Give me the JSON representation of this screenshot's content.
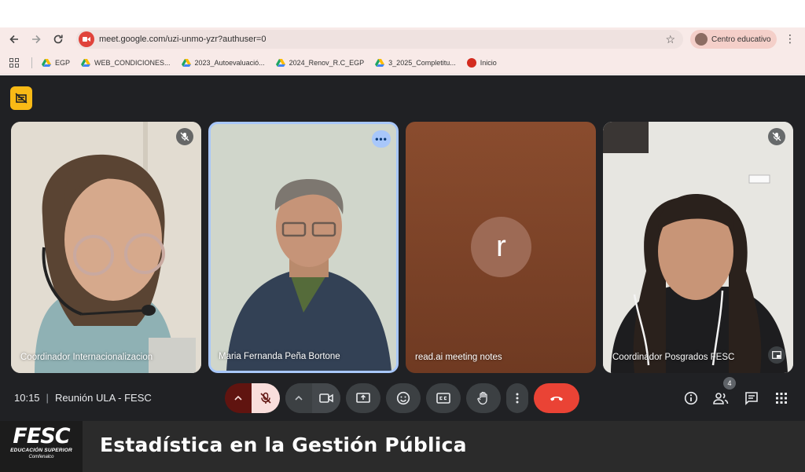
{
  "browser": {
    "url": "meet.google.com/uzi-unmo-yzr?authuser=0",
    "profile_label": "Centro educativo",
    "bookmarks": [
      {
        "label": "EGP",
        "icon": "drive-icon"
      },
      {
        "label": "WEB_CONDICIONES...",
        "icon": "drive-icon"
      },
      {
        "label": "2023_Autoevaluació...",
        "icon": "drive-icon"
      },
      {
        "label": "2024_Renov_R.C_EGP",
        "icon": "drive-icon"
      },
      {
        "label": "3_2025_Completitu...",
        "icon": "drive-icon"
      },
      {
        "label": "Inicio",
        "icon": "fesc-favicon"
      }
    ]
  },
  "meeting": {
    "time": "10:15",
    "name": "Reunión ULA - FESC",
    "participant_count": "4",
    "tiles": [
      {
        "label": "Coordinador Internacionalizacion",
        "muted": true
      },
      {
        "label": "Maria Fernanda Peña Bortone",
        "active_speaker": true
      },
      {
        "label": "read.ai meeting notes",
        "avatar_letter": "r"
      },
      {
        "label": "Coordinador Posgrados FESC",
        "muted": true
      }
    ]
  },
  "footer": {
    "logo_main": "FESC",
    "logo_sub": "EDUCACIÓN SUPERIOR",
    "logo_sub2": "Comfenalco",
    "title": "Estadística en la Gestión Pública"
  },
  "colors": {
    "meet_bg": "#202124",
    "hangup": "#ea4335",
    "host_badge": "#f9ba16",
    "speaker_outline": "#a8c7fa",
    "mic_muted_bg": "#f9dedc",
    "mic_muted_dark": "#601410"
  }
}
